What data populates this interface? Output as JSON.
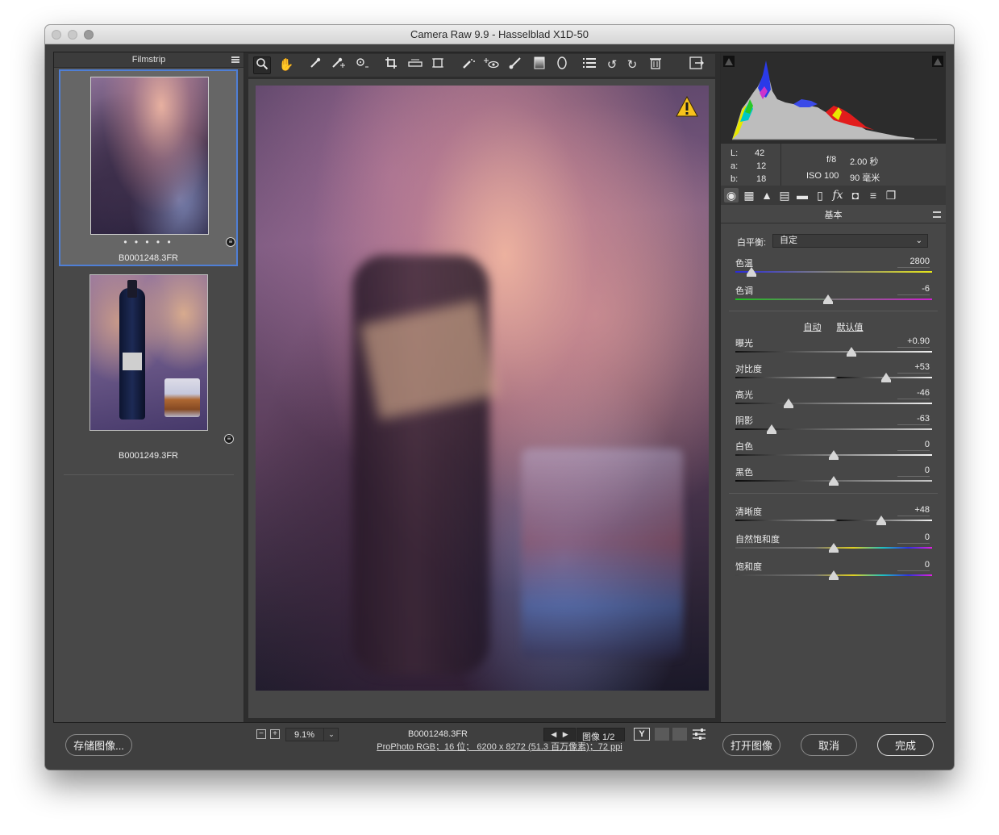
{
  "window": {
    "title": "Camera Raw 9.9 -  Hasselblad X1D-50"
  },
  "filmstrip": {
    "title": "Filmstrip",
    "items": [
      {
        "filename": "B0001248.3FR",
        "rating_dots": "• • • • •",
        "selected": true
      },
      {
        "filename": "B0001249.3FR",
        "rating_dots": "",
        "selected": false
      }
    ]
  },
  "toolbar": {
    "tools": [
      "zoom-tool",
      "hand-tool",
      "white-balance-tool",
      "color-sampler-tool",
      "targeted-adjustment-tool",
      "crop-tool",
      "straighten-tool",
      "transform-tool",
      "spot-removal-tool",
      "red-eye-tool",
      "adjustment-brush",
      "graduated-filter",
      "radial-filter",
      "preferences",
      "rotate-left",
      "rotate-right",
      "delete",
      "toggle-fullscreen"
    ]
  },
  "preview": {
    "warning_icon": "warning-triangle-icon"
  },
  "statusbar": {
    "zoom": "9.1%",
    "filename": "B0001248.3FR",
    "image_counter": "图像 1/2"
  },
  "info": {
    "L_label": "L:",
    "L": "42",
    "a_label": "a:",
    "a": "12",
    "b_label": "b:",
    "b": "18",
    "aperture": "f/8",
    "shutter": "2.00 秒",
    "iso": "ISO 100",
    "focal": "90 毫米"
  },
  "panel": {
    "title": "基本",
    "white_balance_label": "白平衡:",
    "white_balance_value": "自定",
    "auto": "自动",
    "default": "默认值"
  },
  "sliders": {
    "temp": {
      "label": "色温",
      "value": "2800",
      "pos": 0.08
    },
    "tint": {
      "label": "色调",
      "value": "-6",
      "pos": 0.47
    },
    "exposure": {
      "label": "曝光",
      "value": "+0.90",
      "pos": 0.59
    },
    "contrast": {
      "label": "对比度",
      "value": "+53",
      "pos": 0.765
    },
    "highlights": {
      "label": "高光",
      "value": "-46",
      "pos": 0.27
    },
    "shadows": {
      "label": "阴影",
      "value": "-63",
      "pos": 0.185
    },
    "whites": {
      "label": "白色",
      "value": "0",
      "pos": 0.5
    },
    "blacks": {
      "label": "黑色",
      "value": "0",
      "pos": 0.5
    },
    "clarity": {
      "label": "清晰度",
      "value": "+48",
      "pos": 0.74
    },
    "vibrance": {
      "label": "自然饱和度",
      "value": "0",
      "pos": 0.5
    },
    "saturation": {
      "label": "饱和度",
      "value": "0",
      "pos": 0.5
    }
  },
  "footer": {
    "save": "存储图像...",
    "workflow": "ProPhoto RGB；16 位；  6200 x 8272 (51.3 百万像素)；72 ppi",
    "open": "打开图像",
    "cancel": "取消",
    "done": "完成"
  },
  "colors": {
    "selection": "#4f7fd6",
    "panel_bg": "#474747",
    "dark_bg": "#2d2d2d"
  }
}
